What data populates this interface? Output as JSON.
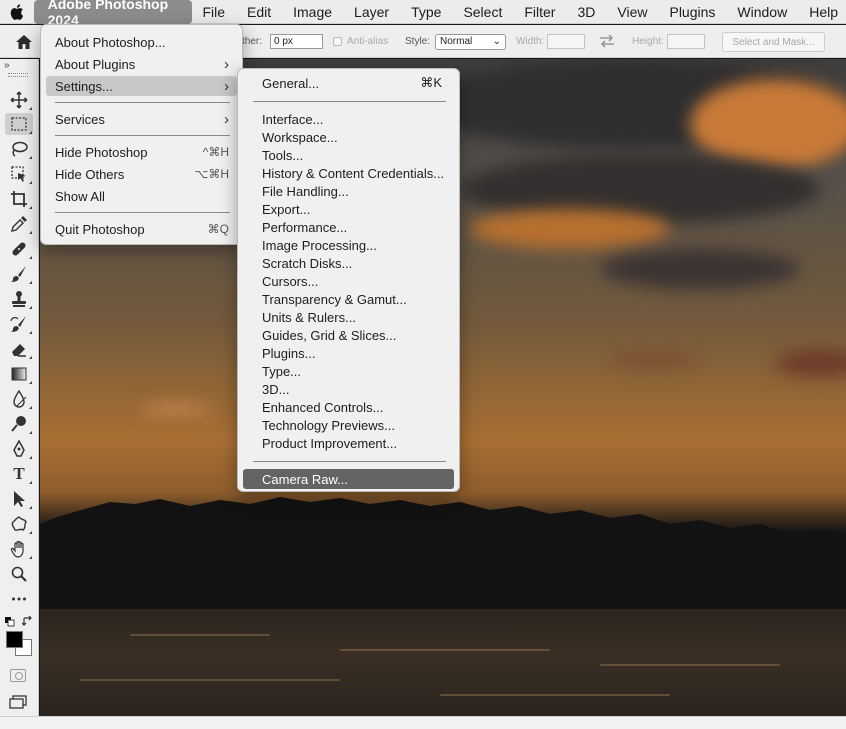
{
  "menubar": {
    "apple_icon": "apple-logo-icon",
    "app_name": "Adobe Photoshop 2024",
    "menus": [
      "File",
      "Edit",
      "Image",
      "Layer",
      "Type",
      "Select",
      "Filter",
      "3D",
      "View",
      "Plugins",
      "Window",
      "Help"
    ]
  },
  "optionsbar": {
    "home_icon": "home-icon",
    "feather_label": "ther:",
    "feather_value": "0 px",
    "antialias_label": "Anti-alias",
    "style_label": "Style:",
    "style_value": "Normal",
    "width_label": "Width:",
    "swap_icon": "swap-arrows-icon",
    "height_label": "Height:",
    "select_mask_label": "Select and Mask..."
  },
  "toolbar": {
    "collapse_label": "»",
    "tools": [
      "move-icon",
      "rectangular-marquee-icon",
      "lasso-icon",
      "object-selection-icon",
      "crop-icon",
      "eyedropper-icon",
      "spot-healing-icon",
      "brush-icon",
      "clone-stamp-icon",
      "history-brush-icon",
      "eraser-icon",
      "gradient-icon",
      "blur-icon",
      "dodge-icon",
      "pen-icon",
      "type-icon",
      "path-selection-icon",
      "custom-shape-icon",
      "hand-icon",
      "zoom-icon",
      "more-tools-icon"
    ],
    "type_glyph": "T",
    "active_tool": "rectangular-marquee-icon",
    "foreground_color": "#000000",
    "background_color": "#ffffff"
  },
  "app_menu": {
    "items": [
      {
        "label": "About Photoshop...",
        "shortcut": ""
      },
      {
        "label": "About Plugins",
        "submenu": true
      },
      {
        "label": "Settings...",
        "submenu": true,
        "highlighted": true
      },
      {
        "label": "Services",
        "submenu": true
      },
      {
        "label": "Hide Photoshop",
        "shortcut": "^⌘H"
      },
      {
        "label": "Hide Others",
        "shortcut": "⌥⌘H"
      },
      {
        "label": "Show All",
        "shortcut": ""
      },
      {
        "label": "Quit Photoshop",
        "shortcut": "⌘Q"
      }
    ],
    "arrow_glyph": "›"
  },
  "settings_menu": {
    "items": [
      {
        "label": "General...",
        "shortcut": "⌘K"
      },
      {
        "label": "Interface..."
      },
      {
        "label": "Workspace..."
      },
      {
        "label": "Tools..."
      },
      {
        "label": "History & Content Credentials..."
      },
      {
        "label": "File Handling..."
      },
      {
        "label": "Export..."
      },
      {
        "label": "Performance..."
      },
      {
        "label": "Image Processing..."
      },
      {
        "label": "Scratch Disks..."
      },
      {
        "label": "Cursors..."
      },
      {
        "label": "Transparency & Gamut..."
      },
      {
        "label": "Units & Rulers..."
      },
      {
        "label": "Guides, Grid & Slices..."
      },
      {
        "label": "Plugins..."
      },
      {
        "label": "Type..."
      },
      {
        "label": "3D..."
      },
      {
        "label": "Enhanced Controls..."
      },
      {
        "label": "Technology Previews..."
      },
      {
        "label": "Product Improvement..."
      },
      {
        "label": "Camera Raw...",
        "selected": true
      }
    ]
  },
  "colors": {
    "menubar_bg": "#ececec",
    "app_name_highlight": "#8c8c8c",
    "menu_highlight": "#c8c8c8",
    "menu_selected": "#646464"
  }
}
